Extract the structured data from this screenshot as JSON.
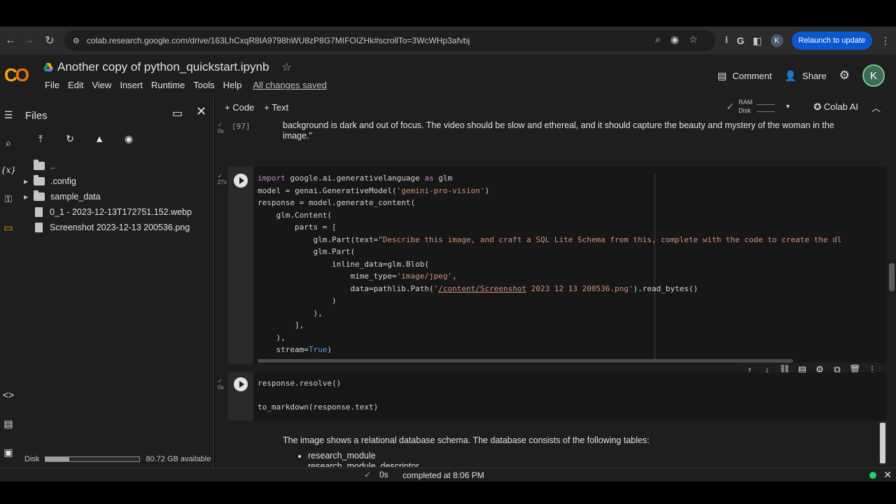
{
  "browser": {
    "url": "colab.research.google.com/drive/163LhCxqR8IA9798hWU8zP8G7MIFOIZHk#scrollTo=3WcWHp3afvbj",
    "relaunch_label": "Relaunch to update",
    "profile_initial": "K"
  },
  "header": {
    "notebook_title": "Another copy of python_quickstart.ipynb",
    "menus": [
      "File",
      "Edit",
      "View",
      "Insert",
      "Runtime",
      "Tools",
      "Help"
    ],
    "save_status": "All changes saved",
    "comment_label": "Comment",
    "share_label": "Share",
    "avatar_initial": "K"
  },
  "files_panel": {
    "title": "Files",
    "tree": [
      {
        "label": "..",
        "type": "folder-up"
      },
      {
        "label": ".config",
        "type": "folder"
      },
      {
        "label": "sample_data",
        "type": "folder"
      },
      {
        "label": "0_1 - 2023-12-13T172751.152.webp",
        "type": "file"
      },
      {
        "label": "Screenshot 2023-12-13 200536.png",
        "type": "file"
      }
    ],
    "disk_label": "Disk",
    "disk_available": "80.72 GB available",
    "disk_used_fraction": 0.25
  },
  "toolbar": {
    "code_label": "+ Code",
    "text_label": "+ Text",
    "ram_label": "RAM",
    "disk_label": "Disk",
    "colab_ai_label": "Colab AI"
  },
  "cells": {
    "prev_output": {
      "exec_time": "0s",
      "exec_count": "[97]",
      "text": "background is dark and out of focus. The video should be slow and ethereal, and it should capture the beauty and mystery of the woman in the image.\""
    },
    "code_cell_1": {
      "exec_time": "27s"
    },
    "code_cell_2": {
      "exec_time": "0s",
      "line1": "response.resolve()",
      "line2": "to_markdown(response.text)"
    },
    "markdown_output": {
      "intro": "The image shows a relational database schema. The database consists of the following tables:",
      "items": [
        "research_module",
        "research_module_descriptor"
      ]
    }
  },
  "status": {
    "time": "0s",
    "message": "completed at 8:06 PM"
  },
  "colors": {
    "accent": "#0b57d0",
    "status_green": "#1ed760",
    "logo_orange": "#f9ab00"
  }
}
